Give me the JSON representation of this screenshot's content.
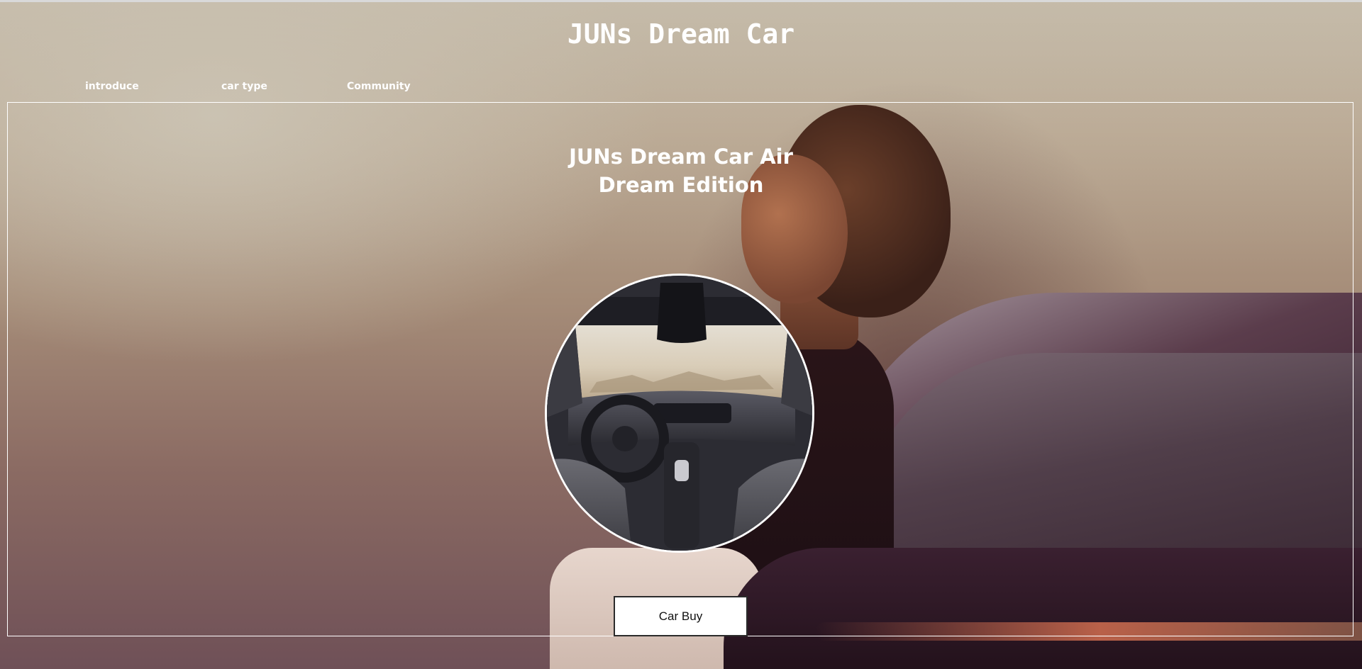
{
  "site": {
    "title": "JUNs Dream Car"
  },
  "nav": {
    "items": [
      {
        "label": "introduce"
      },
      {
        "label": "car type"
      },
      {
        "label": "Community"
      }
    ]
  },
  "hero": {
    "headline_line1": "JUNs Dream Car Air",
    "headline_line2": "Dream Edition",
    "background_image": "woman leaning on car",
    "interior_image": "car interior dashboard (circular)"
  },
  "cta": {
    "label": "Car Buy"
  },
  "colors": {
    "text": "#ffffff",
    "frame_border": "#ffffff",
    "button_bg": "#ffffff",
    "button_text": "#111111"
  }
}
